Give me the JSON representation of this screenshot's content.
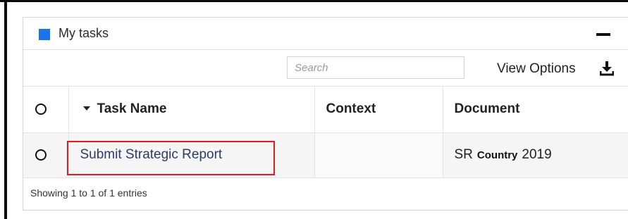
{
  "panel": {
    "title": "My tasks",
    "title_square_color": "#1a73e8",
    "collapse_icon": "minus-icon"
  },
  "toolbar": {
    "search_placeholder": "Search",
    "search_value": "",
    "view_options_label": "View Options",
    "download_icon": "download-icon"
  },
  "table": {
    "columns": [
      {
        "label": "",
        "type": "select-all-radio"
      },
      {
        "label": "Task Name",
        "sort": "descending"
      },
      {
        "label": "Context"
      },
      {
        "label": "Document"
      }
    ],
    "rows": [
      {
        "task_name": "Submit Strategic Report",
        "context": "",
        "document_prefix": "SR",
        "document_middle": "Country",
        "document_suffix": "2019"
      }
    ]
  },
  "footer": {
    "info": "Showing 1 to 1 of 1 entries"
  },
  "colors": {
    "highlight": "#e01b24",
    "link": "#2f3b63"
  }
}
